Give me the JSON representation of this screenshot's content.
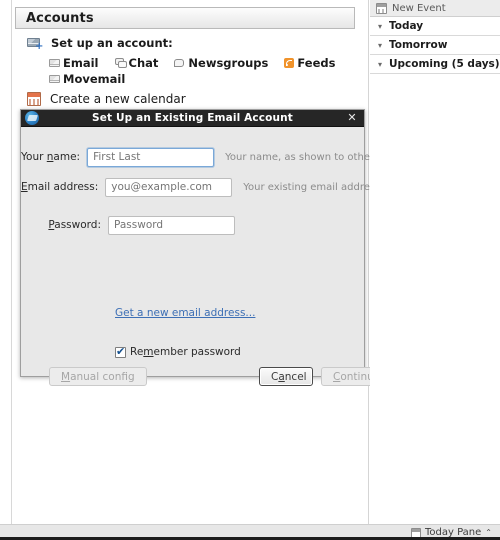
{
  "main": {
    "accounts_header": "Accounts",
    "setup_label": "Set up an account:",
    "account_types": [
      {
        "label": "Email",
        "icon": "envelope-icon"
      },
      {
        "label": "Chat",
        "icon": "chat-bubbles-icon"
      },
      {
        "label": "Newsgroups",
        "icon": "newsgroup-icon"
      },
      {
        "label": "Feeds",
        "icon": "rss-icon"
      },
      {
        "label": "Movemail",
        "icon": "envelope-icon"
      }
    ],
    "calendar_label": "Create a new calendar",
    "account_icon": "account-add-icon",
    "calendar_icon": "calendar-icon"
  },
  "dialog": {
    "title": "Set Up an Existing Email Account",
    "window_icon": "thunderbird-icon",
    "close_icon": "close-icon",
    "fields": [
      {
        "label_pre": "Your ",
        "label_mnemonic": "n",
        "label_post": "ame:",
        "placeholder": "First Last",
        "hint": "Your name, as shown to others",
        "focused": true
      },
      {
        "label_pre": "",
        "label_mnemonic": "E",
        "label_post": "mail address:",
        "placeholder": "you@example.com",
        "hint": "Your existing email address",
        "focused": false
      },
      {
        "label_pre": "",
        "label_mnemonic": "P",
        "label_post": "assword:",
        "placeholder": "Password",
        "hint": "",
        "focused": false
      }
    ],
    "new_address_link": "Get a new email address...",
    "remember": {
      "pre": "Re",
      "mnemonic": "m",
      "post": "ember password",
      "checked": true
    },
    "buttons": {
      "manual": {
        "pre": "",
        "mnemonic": "M",
        "post": "anual config",
        "disabled": true
      },
      "cancel": {
        "pre": "C",
        "mnemonic": "a",
        "post": "ncel",
        "disabled": false,
        "focused": true
      },
      "continue": {
        "pre": "",
        "mnemonic": "C",
        "post": "ontinue",
        "disabled": true
      }
    }
  },
  "sidebar": {
    "new_event": {
      "label": "New Event",
      "icon": "new-event-icon"
    },
    "sections": [
      {
        "label": "Today",
        "chevron": "▾"
      },
      {
        "label": "Tomorrow",
        "chevron": "▾"
      },
      {
        "label": "Upcoming (5 days)",
        "chevron": "▾"
      }
    ]
  },
  "statusbar": {
    "today_pane": "Today Pane",
    "caret": "⌃",
    "icon": "calendar-small-icon"
  }
}
